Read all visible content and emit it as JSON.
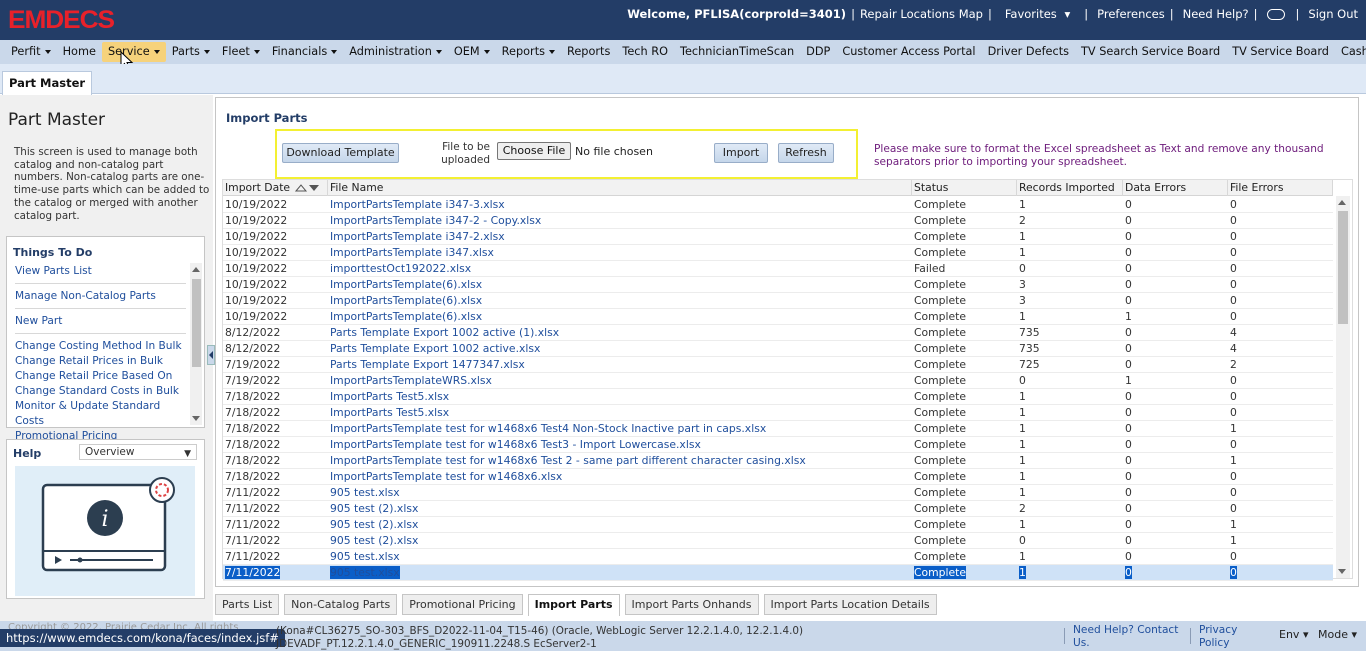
{
  "app": {
    "logo": "EMDECS"
  },
  "topbar": {
    "welcome": "Welcome, PFLISA(corproId=3401)",
    "repair_map": "Repair Locations Map",
    "favorites": "Favorites",
    "preferences": "Preferences",
    "need_help": "Need Help?",
    "sign_out": "Sign Out"
  },
  "nav": [
    "Perfit",
    "Home",
    "Service",
    "Parts",
    "Fleet",
    "Financials",
    "Administration",
    "OEM",
    "Reports",
    "Reports",
    "Tech RO",
    "TechnicianTimeScan",
    "DDP",
    "Customer Access Portal",
    "Driver Defects",
    "TV Search Service Board",
    "TV Service Board",
    "Cashier Shift"
  ],
  "page_tab": "Part Master",
  "left": {
    "title": "Part Master",
    "description": "This screen is used to manage both catalog and non-catalog part numbers. Non-catalog parts are one-time-use parts which can be added to the catalog or merged with another catalog part.",
    "todo_title": "Things To Do",
    "todo": [
      "View Parts List",
      "Manage Non-Catalog Parts",
      "New Part",
      "Change Costing Method In Bulk",
      "Change Retail Prices in Bulk",
      "Change Retail Price Based On",
      "Change Standard Costs in Bulk",
      "Monitor & Update Standard Costs",
      "Promotional Pricing"
    ],
    "help_title": "Help",
    "help_select": "Overview"
  },
  "import": {
    "title": "Import Parts",
    "download": "Download Template",
    "file_label": "File to be uploaded",
    "choose": "Choose File",
    "no_file": "No file chosen",
    "import": "Import",
    "refresh": "Refresh",
    "notice": "Please make sure to format the Excel spreadsheet as Text and remove any thousand separators prior to importing your spreadsheet."
  },
  "table": {
    "columns": [
      "Import Date",
      "File Name",
      "Status",
      "Records Imported",
      "Data Errors",
      "File Errors"
    ],
    "rows": [
      [
        "10/19/2022",
        "ImportPartsTemplate i347-3.xlsx",
        "Complete",
        "1",
        "0",
        "0"
      ],
      [
        "10/19/2022",
        "ImportPartsTemplate i347-2 - Copy.xlsx",
        "Complete",
        "2",
        "0",
        "0"
      ],
      [
        "10/19/2022",
        "ImportPartsTemplate i347-2.xlsx",
        "Complete",
        "1",
        "0",
        "0"
      ],
      [
        "10/19/2022",
        "ImportPartsTemplate i347.xlsx",
        "Complete",
        "1",
        "0",
        "0"
      ],
      [
        "10/19/2022",
        "importtestOct192022.xlsx",
        "Failed",
        "0",
        "0",
        "0"
      ],
      [
        "10/19/2022",
        "ImportPartsTemplate(6).xlsx",
        "Complete",
        "3",
        "0",
        "0"
      ],
      [
        "10/19/2022",
        "ImportPartsTemplate(6).xlsx",
        "Complete",
        "3",
        "0",
        "0"
      ],
      [
        "10/19/2022",
        "ImportPartsTemplate(6).xlsx",
        "Complete",
        "1",
        "1",
        "0"
      ],
      [
        "8/12/2022",
        "Parts Template Export 1002 active (1).xlsx",
        "Complete",
        "735",
        "0",
        "4"
      ],
      [
        "8/12/2022",
        "Parts Template Export 1002 active.xlsx",
        "Complete",
        "735",
        "0",
        "4"
      ],
      [
        "7/19/2022",
        "Parts Template Export 1477347.xlsx",
        "Complete",
        "725",
        "0",
        "2"
      ],
      [
        "7/19/2022",
        "ImportPartsTemplateWRS.xlsx",
        "Complete",
        "0",
        "1",
        "0"
      ],
      [
        "7/18/2022",
        "ImportParts Test5.xlsx",
        "Complete",
        "1",
        "0",
        "0"
      ],
      [
        "7/18/2022",
        "ImportParts Test5.xlsx",
        "Complete",
        "1",
        "0",
        "0"
      ],
      [
        "7/18/2022",
        "ImportPartsTemplate test for w1468x6 Test4 Non-Stock Inactive part in caps.xlsx",
        "Complete",
        "1",
        "0",
        "1"
      ],
      [
        "7/18/2022",
        "ImportPartsTemplate test for w1468x6 Test3 - Import Lowercase.xlsx",
        "Complete",
        "1",
        "0",
        "0"
      ],
      [
        "7/18/2022",
        "ImportPartsTemplate test for w1468x6 Test 2 - same part different character casing.xlsx",
        "Complete",
        "1",
        "0",
        "1"
      ],
      [
        "7/18/2022",
        "ImportPartsTemplate test for w1468x6.xlsx",
        "Complete",
        "1",
        "0",
        "0"
      ],
      [
        "7/11/2022",
        "905 test.xlsx",
        "Complete",
        "1",
        "0",
        "0"
      ],
      [
        "7/11/2022",
        "905 test (2).xlsx",
        "Complete",
        "2",
        "0",
        "0"
      ],
      [
        "7/11/2022",
        "905 test (2).xlsx",
        "Complete",
        "1",
        "0",
        "1"
      ],
      [
        "7/11/2022",
        "905 test (2).xlsx",
        "Complete",
        "0",
        "0",
        "1"
      ],
      [
        "7/11/2022",
        "905 test.xlsx",
        "Complete",
        "1",
        "0",
        "0"
      ],
      [
        "7/11/2022",
        "905 test.xlsx",
        "Complete",
        "1",
        "0",
        "0"
      ]
    ]
  },
  "bottom_tabs": [
    "Parts List",
    "Non-Catalog Parts",
    "Promotional Pricing",
    "Import Parts",
    "Import Parts Onhands",
    "Import Parts Location Details"
  ],
  "footer": {
    "copyright": "Copyright © 2022, Prairie Cedar Inc. All rights",
    "url": "https://www.emdecs.com/kona/faces/index.jsf#",
    "build": "(Kona#CL36275_SO-303_BFS_D2022-11-04_T15-46) (Oracle, WebLogic Server 12.2.1.4.0, 12.2.1.4.0) JDEVADF_PT.12.2.1.4.0_GENERIC_190911.2248.S EcServer2-1",
    "need_help": "Need Help? Contact Us.",
    "privacy": "Privacy Policy",
    "env": "Env",
    "mode": "Mode"
  }
}
